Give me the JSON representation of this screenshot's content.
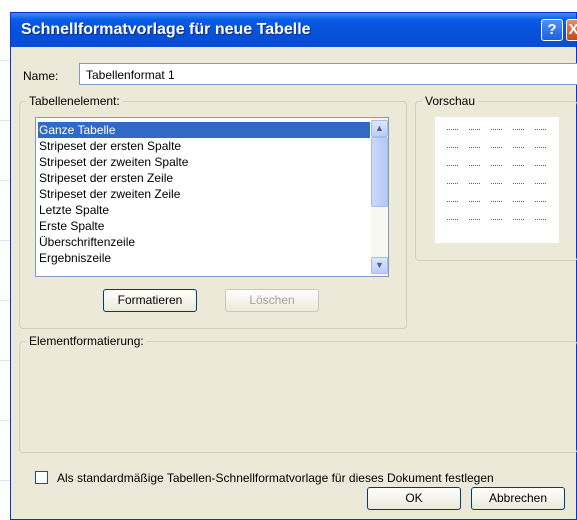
{
  "dialog": {
    "title": "Schnellformatvorlage für neue Tabelle",
    "help_glyph": "?",
    "close_glyph": "X"
  },
  "name_field": {
    "label": "Name:",
    "value": "Tabellenformat 1"
  },
  "table_element": {
    "group_label": "Tabellenelement:",
    "items": [
      {
        "label": "Ganze Tabelle",
        "selected": true
      },
      {
        "label": "Stripeset der ersten Spalte"
      },
      {
        "label": "Stripeset der zweiten Spalte"
      },
      {
        "label": "Stripeset der ersten Zeile"
      },
      {
        "label": "Stripeset der zweiten Zeile"
      },
      {
        "label": "Letzte Spalte"
      },
      {
        "label": "Erste Spalte"
      },
      {
        "label": "Überschriftenzeile"
      },
      {
        "label": "Ergebniszeile"
      }
    ],
    "format_button": "Formatieren",
    "delete_button": "Löschen"
  },
  "preview": {
    "group_label": "Vorschau"
  },
  "element_formatting": {
    "group_label": "Elementformatierung:"
  },
  "default_checkbox": {
    "label": "Als standardmäßige Tabellen-Schnellformatvorlage für dieses Dokument festlegen",
    "checked": false
  },
  "footer": {
    "ok": "OK",
    "cancel": "Abbrechen"
  },
  "colors": {
    "title_bar": "#0551d9",
    "selection": "#316ac5",
    "dialog_bg": "#ece9d8"
  },
  "icons": {
    "help": "help-icon",
    "close": "close-icon",
    "scroll_up": "chevron-up-icon",
    "scroll_down": "chevron-down-icon"
  }
}
